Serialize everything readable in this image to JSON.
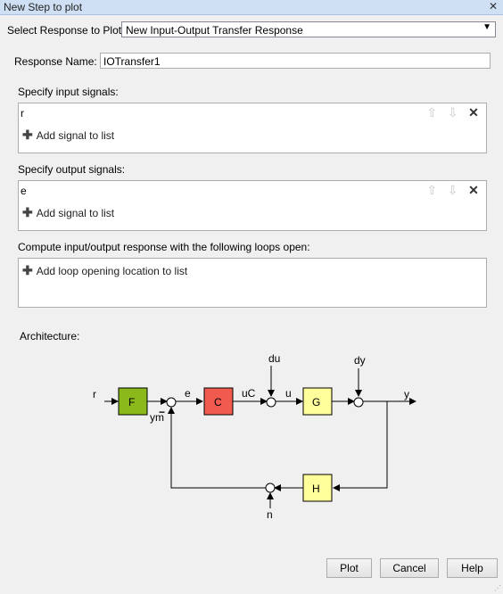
{
  "window": {
    "title": "New Step to plot",
    "close_glyph": "✕"
  },
  "response_select": {
    "label": "Select Response to Plot:",
    "value": "New Input-Output Transfer Response"
  },
  "response_name": {
    "label": "Response Name:",
    "value": "IOTransfer1"
  },
  "input_signals": {
    "label": "Specify input signals:",
    "signal": "r",
    "add_label": "Add signal to list"
  },
  "output_signals": {
    "label": "Specify output signals:",
    "signal": "e",
    "add_label": "Add signal to list"
  },
  "loops": {
    "label": "Compute input/output response with the following loops open:",
    "add_label": "Add loop opening location to list"
  },
  "architecture": {
    "label": "Architecture:",
    "blocks": {
      "F": "F",
      "C": "C",
      "G": "G",
      "H": "H"
    },
    "signals": {
      "r": "r",
      "e": "e",
      "ym": "ym",
      "uC": "uC",
      "u": "u",
      "du": "du",
      "dy": "dy",
      "y": "y",
      "n": "n",
      "minus": "−"
    },
    "colors": {
      "F": "#8bb81a",
      "C": "#f05a4f",
      "G": "#ffff9c",
      "H": "#ffff9c"
    }
  },
  "buttons": {
    "plot": "Plot",
    "cancel": "Cancel",
    "help": "Help"
  },
  "icons": {
    "up": "⇧",
    "down": "⇩",
    "remove": "✕",
    "plus": "✚",
    "dropdown": "▼"
  }
}
